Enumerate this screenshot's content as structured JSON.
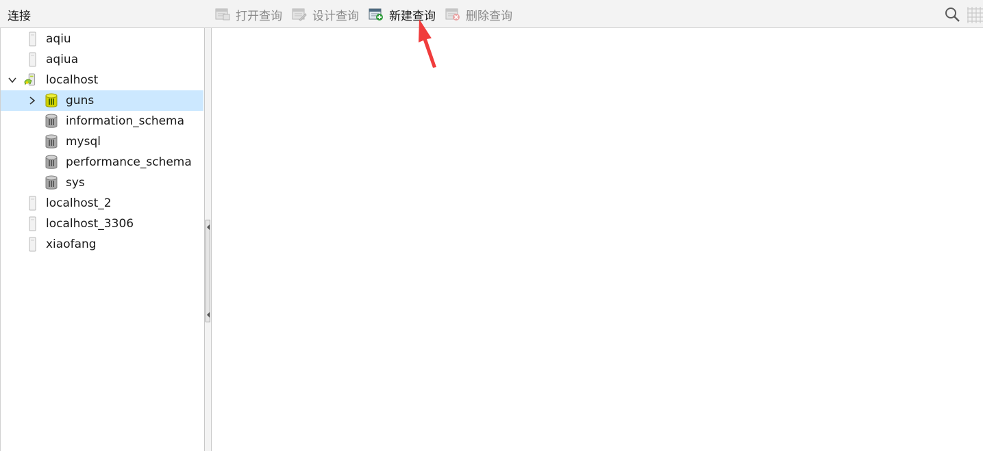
{
  "header": {
    "title": "连接"
  },
  "toolbar": {
    "buttons": [
      {
        "label": "打开查询",
        "enabled": false,
        "icon": "open-query-icon"
      },
      {
        "label": "设计查询",
        "enabled": false,
        "icon": "design-query-icon"
      },
      {
        "label": "新建查询",
        "enabled": true,
        "icon": "new-query-icon"
      },
      {
        "label": "删除查询",
        "enabled": false,
        "icon": "delete-query-icon"
      }
    ],
    "right_icons": [
      "search-icon",
      "grid-view-icon"
    ]
  },
  "tree": {
    "connections": [
      {
        "label": "aqiu",
        "state": "closed"
      },
      {
        "label": "aqiua",
        "state": "closed"
      },
      {
        "label": "localhost",
        "state": "open",
        "expanded": true,
        "databases": [
          {
            "label": "guns",
            "active": true,
            "selected": true
          },
          {
            "label": "information_schema",
            "active": false
          },
          {
            "label": "mysql",
            "active": false
          },
          {
            "label": "performance_schema",
            "active": false
          },
          {
            "label": "sys",
            "active": false
          }
        ]
      },
      {
        "label": "localhost_2",
        "state": "closed"
      },
      {
        "label": "localhost_3306",
        "state": "closed"
      },
      {
        "label": "xiaofang",
        "state": "closed"
      }
    ]
  },
  "colors": {
    "selection": "#cce8ff",
    "annotation": "#f03c3c",
    "db_active": "#d2d400",
    "db_inactive": "#9a9a9a"
  }
}
